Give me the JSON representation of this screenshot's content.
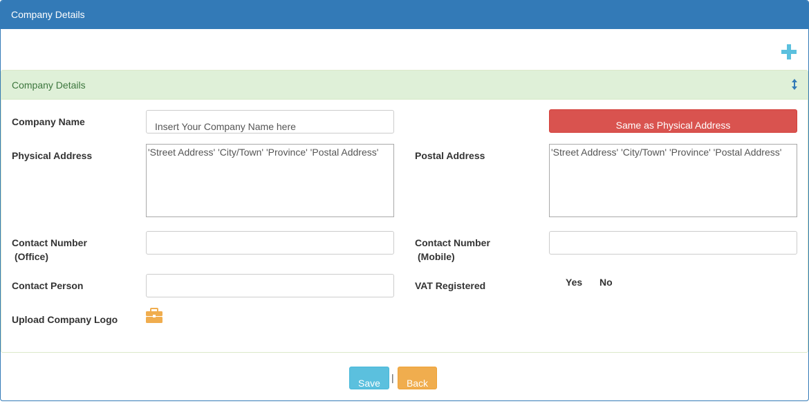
{
  "header": {
    "title": "Company Details"
  },
  "section": {
    "title": "Company Details"
  },
  "fields": {
    "company_name_label": "Company Name",
    "company_name_placeholder": "Insert Your Company Name here",
    "physical_address_label": "Physical Address",
    "physical_address_value": "'Street Address' 'City/Town' 'Province' 'Postal Address'",
    "postal_address_label": "Postal Address",
    "postal_address_value": "'Street Address' 'City/Town' 'Province' 'Postal Address'",
    "same_as_physical_label": "Same as Physical Address",
    "contact_office_label_line1": "Contact Number",
    "contact_office_label_line2": "(Office)",
    "contact_mobile_label_line1": "Contact Number",
    "contact_mobile_label_line2": "(Mobile)",
    "contact_person_label": "Contact Person",
    "vat_label": "VAT Registered",
    "vat_yes": "Yes",
    "vat_no": "No",
    "upload_logo_label": "Upload Company Logo"
  },
  "footer": {
    "save_label": "Save",
    "separator": "|",
    "back_label": "Back"
  },
  "icons": {
    "add": "plus-icon",
    "toggle": "vertical-resize-icon",
    "upload": "briefcase-icon"
  },
  "colors": {
    "primary": "#337ab7",
    "success_bg": "#dff0d8",
    "danger": "#d9534f",
    "info": "#5bc0de",
    "warning": "#f0ad4e"
  }
}
